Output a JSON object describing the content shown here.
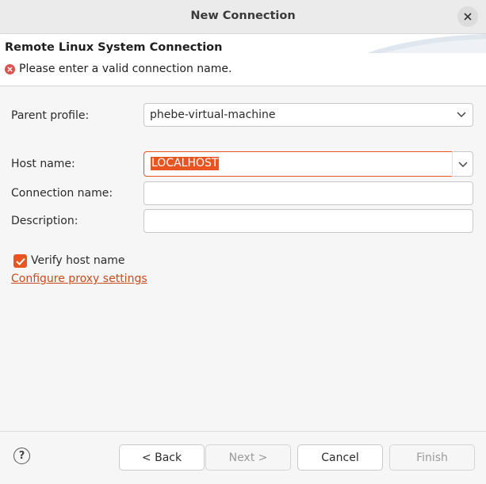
{
  "window": {
    "title": "New Connection"
  },
  "wizard": {
    "title": "Remote Linux System Connection",
    "error_message": "Please enter a valid connection name."
  },
  "form": {
    "parent_profile": {
      "label": "Parent profile:",
      "value": "phebe-virtual-machine"
    },
    "host_name": {
      "label": "Host name:",
      "value": "LOCALHOST"
    },
    "connection_name": {
      "label": "Connection name:",
      "value": ""
    },
    "description": {
      "label": "Description:",
      "value": ""
    },
    "verify_host": {
      "label": "Verify host name",
      "checked": true
    },
    "proxy_link": "Configure proxy settings"
  },
  "buttons": {
    "help": "?",
    "back": "< Back",
    "next": "Next >",
    "cancel": "Cancel",
    "finish": "Finish"
  },
  "colors": {
    "accent": "#e95420",
    "error": "#d9534f"
  }
}
